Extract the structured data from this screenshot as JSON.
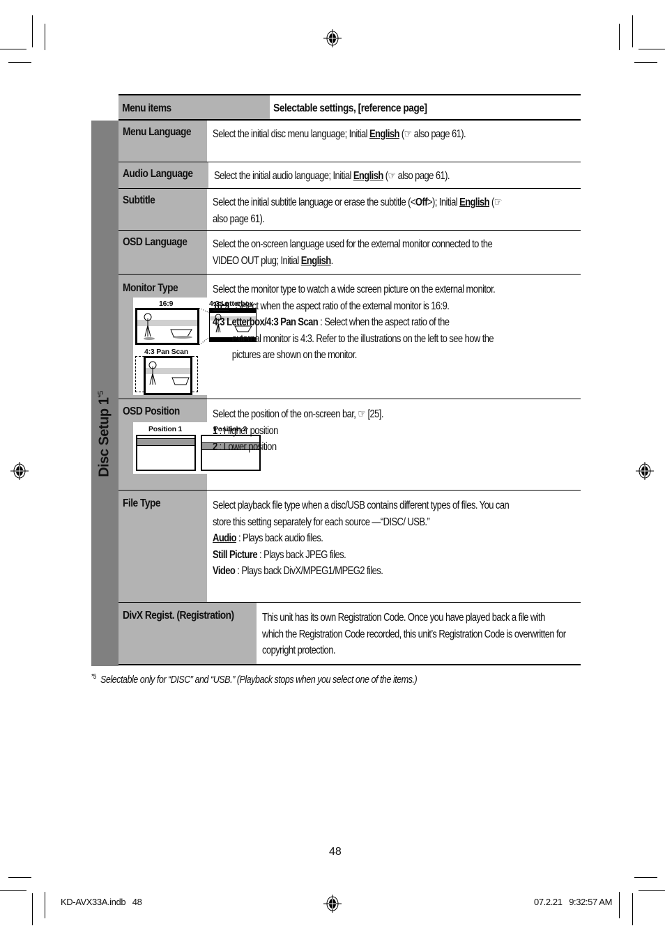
{
  "table": {
    "headers": {
      "menu_items": "Menu items",
      "selectable_settings": "Selectable settings, [reference page]"
    },
    "section_label": "Disc Setup 1",
    "section_footnote_ref": "*5",
    "rows": [
      {
        "name": "Menu Language",
        "desc_pre": "Select the initial disc menu language; Initial ",
        "desc_bold": "English",
        "desc_post": " (☞ also page 61)."
      },
      {
        "name": "Audio Language",
        "desc_pre": "Select the initial audio language; Initial ",
        "desc_bold": "English",
        "desc_post": " (☞ also page 61)."
      },
      {
        "name": "Subtitle",
        "desc_pre": "Select the initial subtitle language or erase the subtitle (<",
        "desc_off": "Off",
        "desc_mid": ">); Initial ",
        "desc_bold": "English",
        "desc_post": " (☞ also page 61)."
      },
      {
        "name": "OSD Language",
        "desc_pre": "Select the on-screen language used for the external monitor connected to the VIDEO OUT plug; Initial ",
        "desc_bold": "English",
        "desc_post": "."
      },
      {
        "name": "Monitor Type",
        "desc_intro": "Select the monitor type to watch a wide screen picture on the external monitor.",
        "option1_key": "16:9",
        "option1_text": " : Select when the aspect ratio of the external monitor is 16:9.",
        "option2_key": "4:3 Letterbox/4:3 Pan Scan",
        "option2_text": " : Select when the aspect ratio of the",
        "option2_cont": "external monitor is 4:3. Refer to the illustrations on the left to see how the pictures are shown on the monitor.",
        "illustration": {
          "label_169": "16:9",
          "label_letterbox": "4:3 Letterbox",
          "label_panscan": "4:3 Pan Scan"
        }
      },
      {
        "name": "OSD Position",
        "desc_intro": "Select the position of the on-screen bar, ☞ [25].",
        "option1_key": "1",
        "option1_text": " : Higher position",
        "option2_key": "2",
        "option2_text": " : Lower position",
        "illustration": {
          "label_pos1": "Position 1",
          "label_pos2": "Position 2"
        }
      },
      {
        "name": "File Type",
        "desc_intro": "Select playback file type when a disc/USB contains different types of files. You can store this setting separately for each source —“DISC/ USB.”",
        "option1_key": "Audio",
        "option1_text": " : Plays back audio files.",
        "option2_key": "Still Picture",
        "option2_text": " : Plays back JPEG files.",
        "option3_key": "Video",
        "option3_text": " : Plays back DivX/MPEG1/MPEG2 files."
      },
      {
        "name": "DivX Regist. (Registration)",
        "desc_intro": "This unit has its own Registration Code. Once you have played back a file with which the Registration Code recorded, this unit’s Registration Code is overwritten for copyright protection."
      }
    ]
  },
  "footnote": {
    "marker": "*5",
    "text": "Selectable only for “DISC” and “USB.” (Playback stops when you select one of the items.)"
  },
  "page_number": "48",
  "slug": {
    "file": "KD-AVX33A.indb   48",
    "timestamp": "07.2.21   9:32:57 AM"
  }
}
